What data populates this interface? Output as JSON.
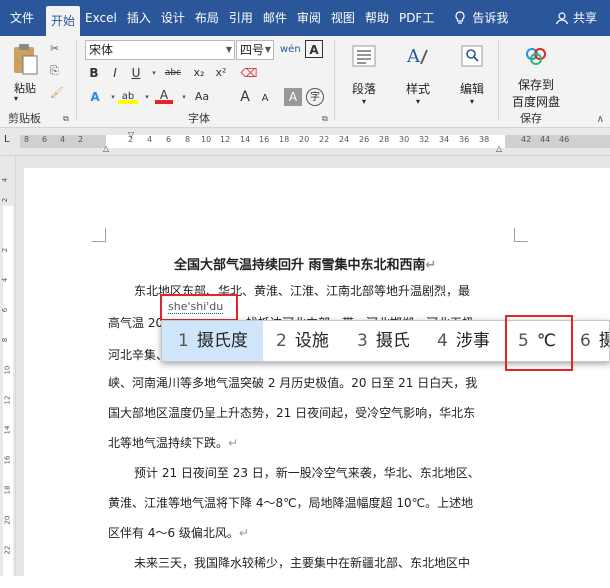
{
  "tabs": [
    "文件",
    "开始",
    "Excel",
    "插入",
    "设计",
    "布局",
    "引用",
    "邮件",
    "审阅",
    "视图",
    "帮助",
    "PDF工"
  ],
  "tell_me": "告诉我",
  "share": "共享",
  "clipboard": {
    "paste": "粘贴",
    "group": "剪贴板"
  },
  "font": {
    "name": "宋体",
    "size": "四号",
    "group": "字体",
    "buttons": [
      "B",
      "I",
      "U",
      "abc",
      "x₂",
      "x²",
      "A",
      "A",
      "Aa",
      "A",
      "A"
    ]
  },
  "paragraph": {
    "label": "段落"
  },
  "styles": {
    "label": "样式"
  },
  "editing": {
    "label": "编辑"
  },
  "save": {
    "label1": "保存到",
    "label2": "百度网盘",
    "group": "保存"
  },
  "ruler": {
    "numbers": [
      "8",
      "6",
      "4",
      "2",
      "2",
      "4",
      "6",
      "8",
      "10",
      "12",
      "14",
      "16",
      "18",
      "20",
      "22",
      "24",
      "26",
      "28",
      "30",
      "32",
      "34",
      "36",
      "38",
      "42",
      "44",
      "46"
    ]
  },
  "vruler": {
    "numbers": [
      "4",
      "2",
      "2",
      "4",
      "6",
      "8",
      "10",
      "12",
      "14",
      "16",
      "18",
      "20",
      "22"
    ]
  },
  "document": {
    "title": "全国大部气温持续回升  雨雪集中东北和西南",
    "lines": [
      "东北地区东部、华北、黄淮、江淮、江南北部等地升温剧烈，最",
      "高气温 20",
      "找抵达河北中部一带，河北邯郸、河北无极、",
      "河北辛集、",
      "峡、河南渑川等多地气温突破 2 月历史极值。20 日至 21 日白天，我",
      "国大部地区温度仍呈上升态势，21 日夜间起，受冷空气影响，华北东",
      "北等地气温持续下跌。",
      "预计 21 日夜间至 23 日，新一股冷空气来袭，华北、东北地区、",
      "黄淮、江淮等地气温将下降 4～8℃，局地降温幅度超 10℃。上述地",
      "区伴有 4～6 级偏北风。",
      "未来三天，我国降水较稀少，主要集中在新疆北部、东北地区中"
    ]
  },
  "composition": "she'shi'du",
  "ime": {
    "candidates": [
      {
        "num": "1",
        "text": "摄氏度"
      },
      {
        "num": "2",
        "text": "设施"
      },
      {
        "num": "3",
        "text": "摄氏"
      },
      {
        "num": "4",
        "text": "涉事"
      },
      {
        "num": "5",
        "text": "℃"
      },
      {
        "num": "6",
        "text": "摄"
      }
    ]
  },
  "colors": {
    "accent": "#2b579a",
    "highlight": "#e3242b",
    "selected": "#cfe6fa"
  }
}
